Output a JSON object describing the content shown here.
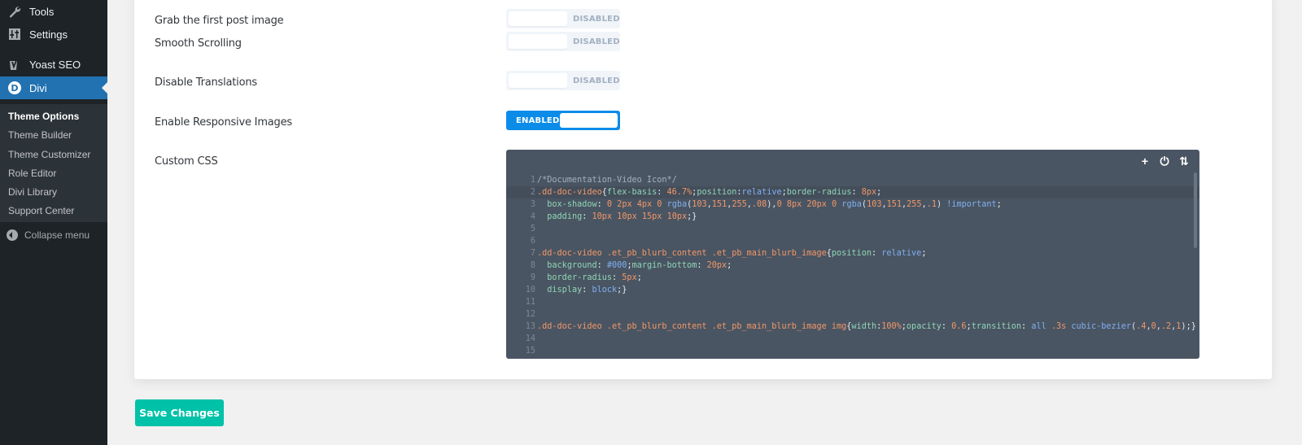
{
  "sidebar": {
    "menu": [
      {
        "label": "Tools",
        "icon": "wrench-icon"
      },
      {
        "label": "Settings",
        "icon": "settings-icon"
      },
      {
        "label": "Yoast SEO",
        "icon": "yoast-icon"
      },
      {
        "label": "Divi",
        "icon": "divi-icon",
        "active": true
      }
    ],
    "submenu": [
      {
        "label": "Theme Options",
        "current": true
      },
      {
        "label": "Theme Builder"
      },
      {
        "label": "Theme Customizer"
      },
      {
        "label": "Role Editor"
      },
      {
        "label": "Divi Library"
      },
      {
        "label": "Support Center"
      }
    ],
    "collapse_label": "Collapse menu"
  },
  "options": [
    {
      "label": "Grab the first post image",
      "state": "DISABLED",
      "enabled": false
    },
    {
      "label": "Smooth Scrolling",
      "state": "DISABLED",
      "enabled": false
    },
    {
      "label": "Disable Translations",
      "state": "DISABLED",
      "enabled": false
    },
    {
      "label": "Enable Responsive Images",
      "state": "ENABLED",
      "enabled": true
    }
  ],
  "custom_css": {
    "label": "Custom CSS",
    "tools": [
      {
        "name": "add-icon",
        "glyph": "+"
      },
      {
        "name": "power-icon",
        "glyph": "⏻"
      },
      {
        "name": "sort-icon",
        "glyph": "⇅"
      }
    ],
    "lines": [
      "/*Documentation-Video Icon*/",
      ".dd-doc-video{flex-basis: 46.7%;position:relative;border-radius: 8px;",
      "  box-shadow: 0 2px 4px 0 rgba(103,151,255,.08),0 8px 20px 0 rgba(103,151,255,.1) !important;",
      "  padding: 10px 10px 15px 10px;}",
      "",
      "",
      ".dd-doc-video .et_pb_blurb_content .et_pb_main_blurb_image{position: relative;",
      "  background: #000;margin-bottom: 20px;",
      "  border-radius: 5px;",
      "  display: block;}",
      "",
      "",
      ".dd-doc-video .et_pb_blurb_content .et_pb_main_blurb_image img{width:100%;opacity: 0.6;transition: all .3s cubic-bezier(.4,0,.2,1);}",
      "",
      ""
    ]
  },
  "save_label": "Save Changes"
}
